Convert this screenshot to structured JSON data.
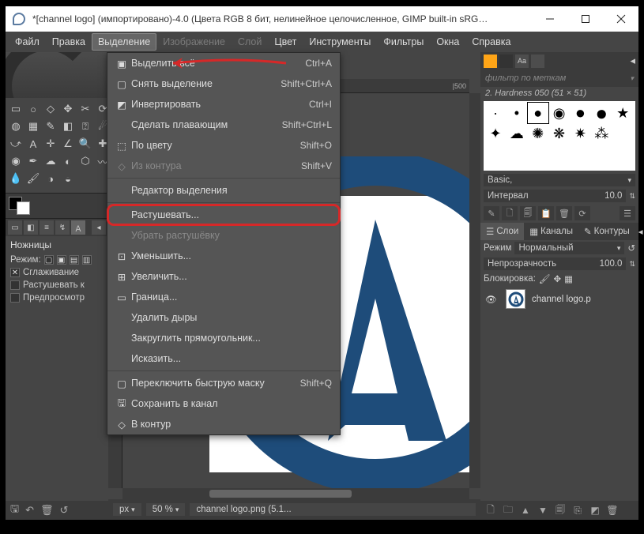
{
  "titlebar": {
    "title": "*[channel logo] (импортировано)-4.0 (Цвета RGB 8 бит, нелинейное целочисленное, GIMP built-in sRGB,..."
  },
  "menubar": {
    "items": [
      "Файл",
      "Правка",
      "Выделение",
      "Изображение",
      "Слой",
      "Цвет",
      "Инструменты",
      "Фильтры",
      "Окна",
      "Справка"
    ]
  },
  "dropdown": {
    "items": [
      {
        "label": "Выделить всё",
        "accel": "Ctrl+A",
        "enabled": true
      },
      {
        "label": "Снять выделение",
        "accel": "Shift+Ctrl+A",
        "enabled": true
      },
      {
        "label": "Инвертировать",
        "accel": "Ctrl+I",
        "enabled": true
      },
      {
        "label": "Сделать плавающим",
        "accel": "Shift+Ctrl+L",
        "enabled": true
      },
      {
        "label": "По цвету",
        "accel": "Shift+O",
        "enabled": true
      },
      {
        "label": "Из контура",
        "accel": "Shift+V",
        "enabled": false
      },
      {
        "sep": true
      },
      {
        "label": "Редактор выделения",
        "accel": "",
        "enabled": true
      },
      {
        "sep": true
      },
      {
        "label": "Растушевать...",
        "accel": "",
        "enabled": true,
        "highlight": true
      },
      {
        "label": "Убрать растушёвку",
        "accel": "",
        "enabled": false
      },
      {
        "label": "Уменьшить...",
        "accel": "",
        "enabled": true
      },
      {
        "label": "Увеличить...",
        "accel": "",
        "enabled": true
      },
      {
        "label": "Граница...",
        "accel": "",
        "enabled": true
      },
      {
        "label": "Удалить дыры",
        "accel": "",
        "enabled": true
      },
      {
        "label": "Закруглить прямоугольник...",
        "accel": "",
        "enabled": true
      },
      {
        "label": "Исказить...",
        "accel": "",
        "enabled": true
      },
      {
        "sep": true
      },
      {
        "label": "Переключить быструю маску",
        "accel": "Shift+Q",
        "enabled": true
      },
      {
        "label": "Сохранить в канал",
        "accel": "",
        "enabled": true
      },
      {
        "label": "В контур",
        "accel": "",
        "enabled": true
      }
    ]
  },
  "toolbox": {
    "options_title": "Ножницы",
    "mode_label": "Режим:",
    "check_antialias": "Сглаживание",
    "check_feather": "Растушевать к",
    "check_preview": "Предпросмотр"
  },
  "ruler": {
    "mark": "|500"
  },
  "statusbar": {
    "unit": "px",
    "zoom": "50 %",
    "file": "channel logo.png (5.1..."
  },
  "right": {
    "filter_placeholder": "фильтр по меткам",
    "brush_line": "2. Hardness 050 (51 × 51)",
    "preset_label": "Basic,",
    "interval_label": "Интервал",
    "interval_value": "10.0",
    "tabs2": {
      "layers": "Слои",
      "channels": "Каналы",
      "paths": "Контуры"
    },
    "mode_label": "Режим",
    "mode_value": "Нормальный",
    "opacity_label": "Непрозрачность",
    "opacity_value": "100.0",
    "lock_label": "Блокировка:",
    "layer_name": "channel logo.p"
  }
}
